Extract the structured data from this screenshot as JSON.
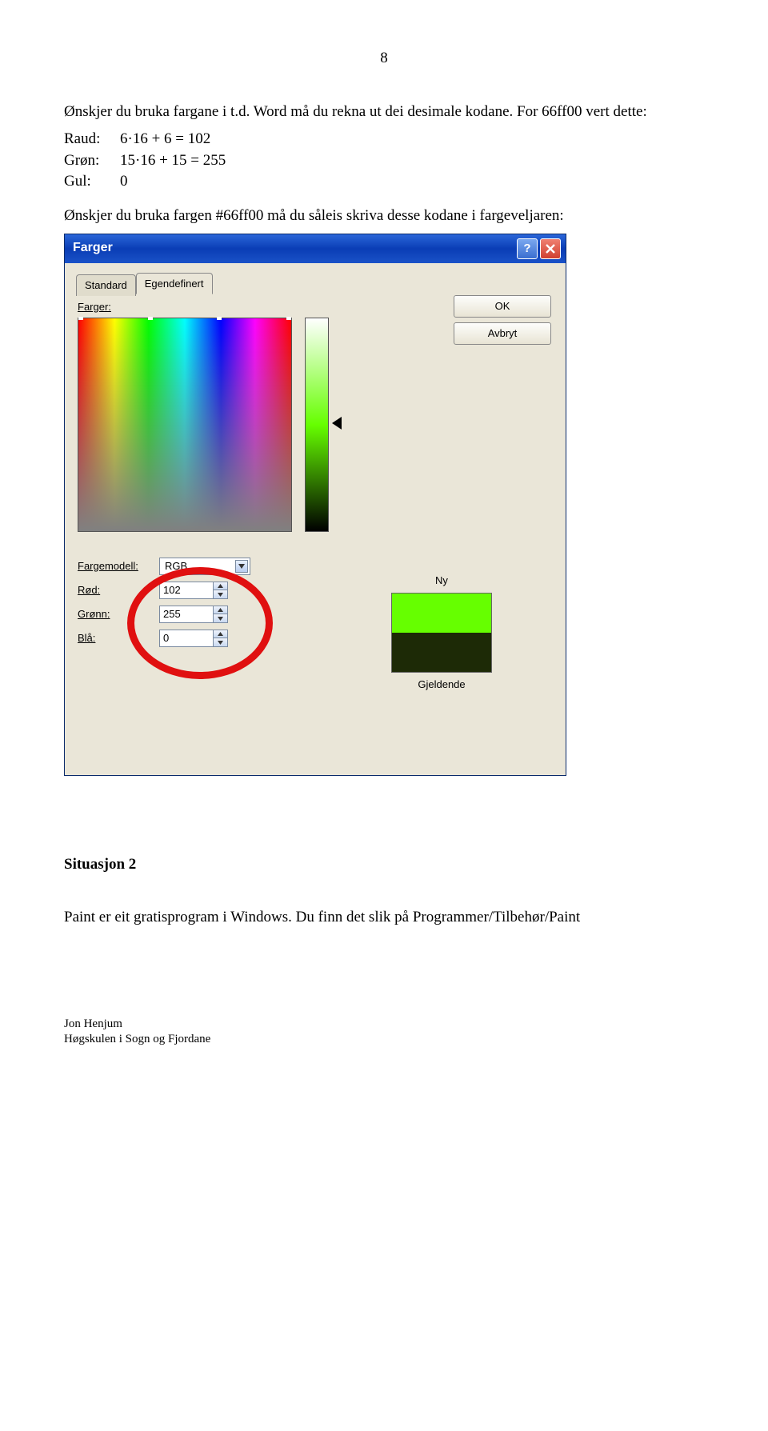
{
  "page_number": "8",
  "intro_text": "Ønskjer du bruka fargane i t.d. Word må du rekna ut dei desimale kodane. For 66ff00 vert dette:",
  "calc": {
    "raud_label": "Raud:",
    "raud_val": "6·16 + 6 = 102",
    "gron_label": "Grøn:",
    "gron_val": "15·16 + 15 = 255",
    "gul_label": "Gul:",
    "gul_val": "0"
  },
  "followup_text": "Ønskjer du bruka fargen #66ff00 må du såleis skriva desse kodane i fargeveljaren:",
  "dialog": {
    "title": "Farger",
    "tabs": {
      "standard": "Standard",
      "egendefinert": "Egendefinert"
    },
    "farger_label": "Farger:",
    "ok_btn": "OK",
    "avbryt_btn": "Avbryt",
    "fargemodell_label": "Fargemodell:",
    "fargemodell_value": "RGB",
    "rod_label": "Rød:",
    "rod_value": "102",
    "gronn_label": "Grønn:",
    "gronn_value": "255",
    "bla_label": "Blå:",
    "bla_value": "0",
    "ny_label": "Ny",
    "gjeldende_label": "Gjeldende"
  },
  "situation_heading": "Situasjon 2",
  "situation_text": "Paint er eit gratisprogram i Windows. Du finn det slik på Programmer/Tilbehør/Paint",
  "footer_author": "Jon Henjum",
  "footer_inst": "Høgskulen i Sogn og Fjordane"
}
